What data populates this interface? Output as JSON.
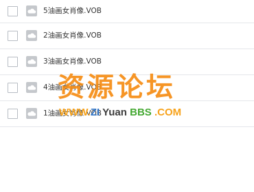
{
  "files": [
    {
      "name": "5油画女肖像.VOB",
      "icon": "cloud-file-icon",
      "checked": false
    },
    {
      "name": "2油画女肖像.VOB",
      "icon": "cloud-file-icon",
      "checked": false
    },
    {
      "name": "3油画女肖像.VOB",
      "icon": "cloud-file-icon",
      "checked": false
    },
    {
      "name": "4油画女肖像.VOB",
      "icon": "cloud-file-icon",
      "checked": false
    },
    {
      "name": "1油画女肖像.VOB",
      "icon": "cloud-file-icon",
      "checked": false
    }
  ],
  "watermark": {
    "title": "资源论坛",
    "url_www": "WWW.",
    "url_zi": "ZI",
    "url_yuan": "Yuan",
    "url_bbs": "BBS",
    "url_com": ".COM"
  },
  "colors": {
    "watermark_title": "#f58c14",
    "watermark_www": "#f7a21a",
    "watermark_zi": "#2f74c7",
    "watermark_yuan": "#3d3d3d",
    "watermark_bbs": "#44a832",
    "row_divider": "#e4e6ea",
    "icon_gray": "#c5c8cc"
  }
}
